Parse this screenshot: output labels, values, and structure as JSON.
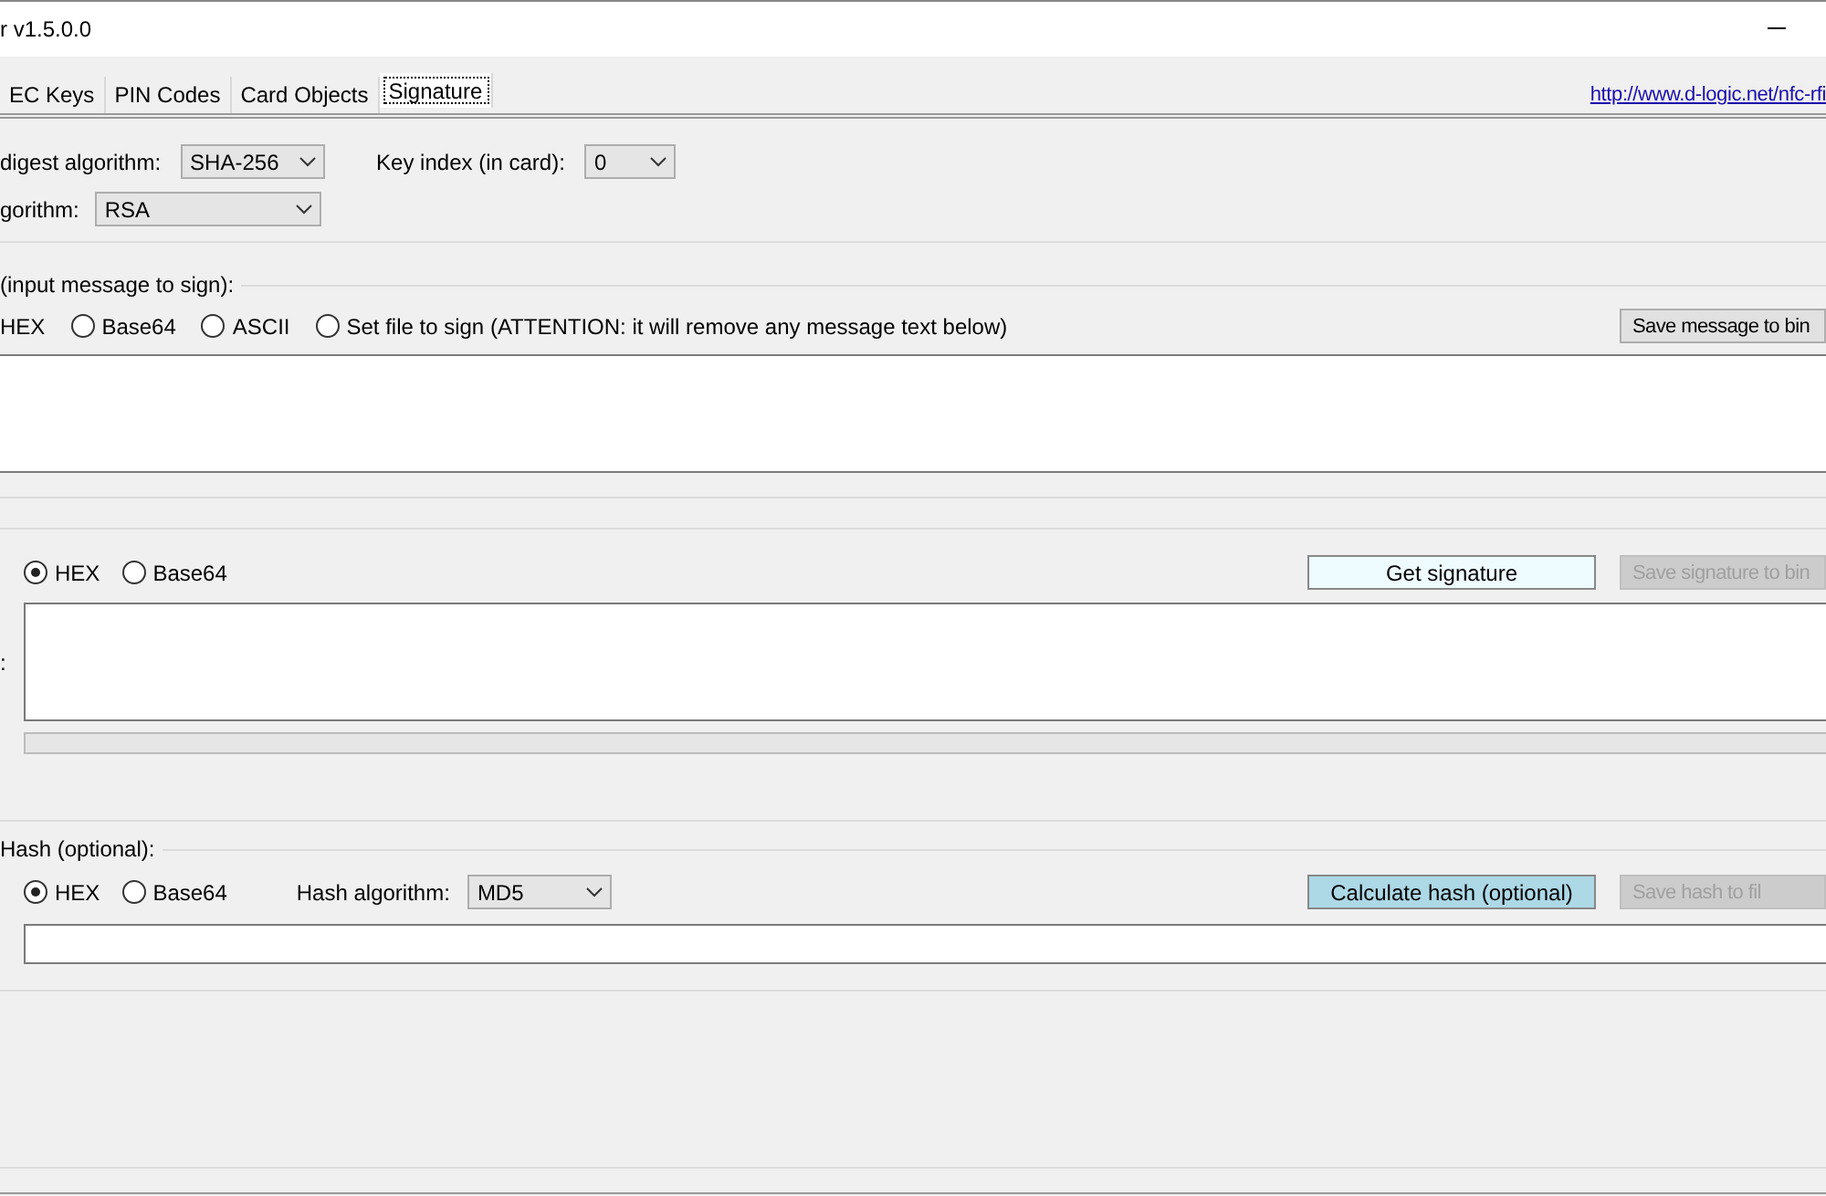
{
  "window": {
    "title": "r v1.5.0.0"
  },
  "tabs": [
    {
      "label": "EC Keys",
      "selected": false
    },
    {
      "label": "PIN Codes",
      "selected": false
    },
    {
      "label": "Card Objects",
      "selected": false
    },
    {
      "label": "Signature",
      "selected": true
    }
  ],
  "link": "http://www.d-logic.net/nfc-rfi",
  "settings": {
    "digest_label": "digest algorithm:",
    "digest_value": "SHA-256",
    "key_index_label": "Key index (in card):",
    "key_index_value": "0",
    "algorithm_label": "gorithm:",
    "algorithm_value": "RSA"
  },
  "message": {
    "group_label": "(input message to sign):",
    "cut_option_label": "HEX",
    "options": [
      {
        "label": "Base64",
        "selected": false
      },
      {
        "label": "ASCII",
        "selected": false
      },
      {
        "label": "Set file to sign (ATTENTION: it will remove any message text below)",
        "selected": false
      }
    ],
    "save_button": {
      "label": "Save message to bin",
      "disabled": false
    }
  },
  "signature": {
    "options": [
      {
        "label": "HEX",
        "selected": true
      },
      {
        "label": "Base64",
        "selected": false
      }
    ],
    "get_button": "Get signature",
    "save_button": {
      "label": "Save signature to bin",
      "disabled": true
    },
    "field_label": ":",
    "progress": {
      "level": 0
    }
  },
  "hash": {
    "group_label": "Hash (optional):",
    "options": [
      {
        "label": "HEX",
        "selected": true
      },
      {
        "label": "Base64",
        "selected": false
      }
    ],
    "algorithm_label": "Hash algorithm:",
    "algorithm_value": "MD5",
    "calc_button": "Calculate hash (optional)",
    "save_button": {
      "label": "Save hash to fil",
      "disabled": true
    }
  }
}
